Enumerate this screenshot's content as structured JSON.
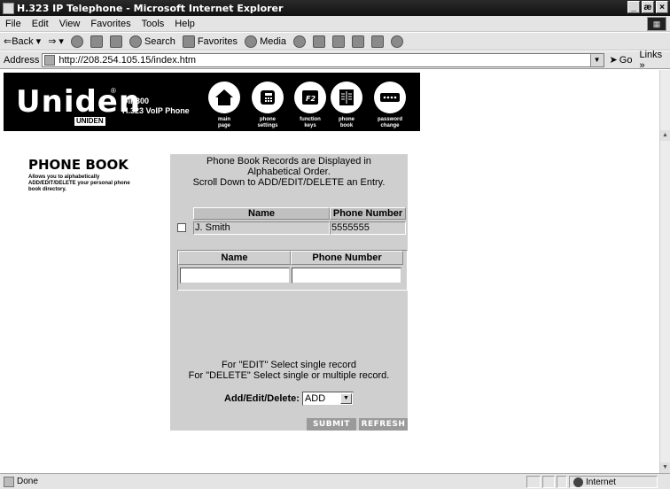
{
  "window": {
    "title": "H.323 IP Telephone - Microsoft Internet Explorer",
    "controls": [
      "_",
      "æ",
      "×"
    ]
  },
  "menu": [
    "File",
    "Edit",
    "View",
    "Favorites",
    "Tools",
    "Help"
  ],
  "toolbar": {
    "back": "⇐Back",
    "forward": "⇒",
    "search": "Search",
    "favorites": "Favorites",
    "media": "Media"
  },
  "address": {
    "label": "Address",
    "url": "http://208.254.105.15/index.htm",
    "go": "Go",
    "links": "Links »"
  },
  "banner": {
    "brand": "Uniden",
    "brand_sub": "UNIDEN",
    "model_line1": "UIP300",
    "model_line2": "H.323 VoIP Phone",
    "nav": [
      {
        "label1": "main",
        "label2": "page",
        "icon": "house-icon"
      },
      {
        "label1": "phone",
        "label2": "settings",
        "icon": "phone-icon"
      },
      {
        "label1": "function",
        "label2": "keys",
        "icon": "function-key-icon",
        "glyph": "F2"
      },
      {
        "label1": "phone",
        "label2": "book",
        "icon": "book-icon"
      },
      {
        "label1": "password",
        "label2": "change",
        "icon": "password-icon"
      }
    ]
  },
  "left": {
    "title": "PHONE BOOK",
    "description": "Allows you to alphabetically ADD/EDIT/DELETE your personal phone book directory."
  },
  "panel": {
    "notice_line1": "Phone Book Records are Displayed in",
    "notice_line2": "Alphabetical Order.",
    "notice_line3": "Scroll Down to ADD/EDIT/DELETE an Entry.",
    "records_headers": {
      "name": "Name",
      "phone": "Phone Number"
    },
    "records": [
      {
        "name": "J. Smith",
        "phone": "5555555",
        "checked": false
      }
    ],
    "entry_headers": {
      "name": "Name",
      "phone": "Phone Number"
    },
    "entry_values": {
      "name": "",
      "phone": ""
    },
    "instruction_line1": "For \"EDIT\" Select single record",
    "instruction_line2": "For \"DELETE\" Select single or multiple record.",
    "action_label": "Add/Edit/Delete:",
    "action_value": "ADD",
    "submit": "SUBMIT",
    "refresh": "REFRESH"
  },
  "status": {
    "text": "Done",
    "zone": "Internet"
  }
}
